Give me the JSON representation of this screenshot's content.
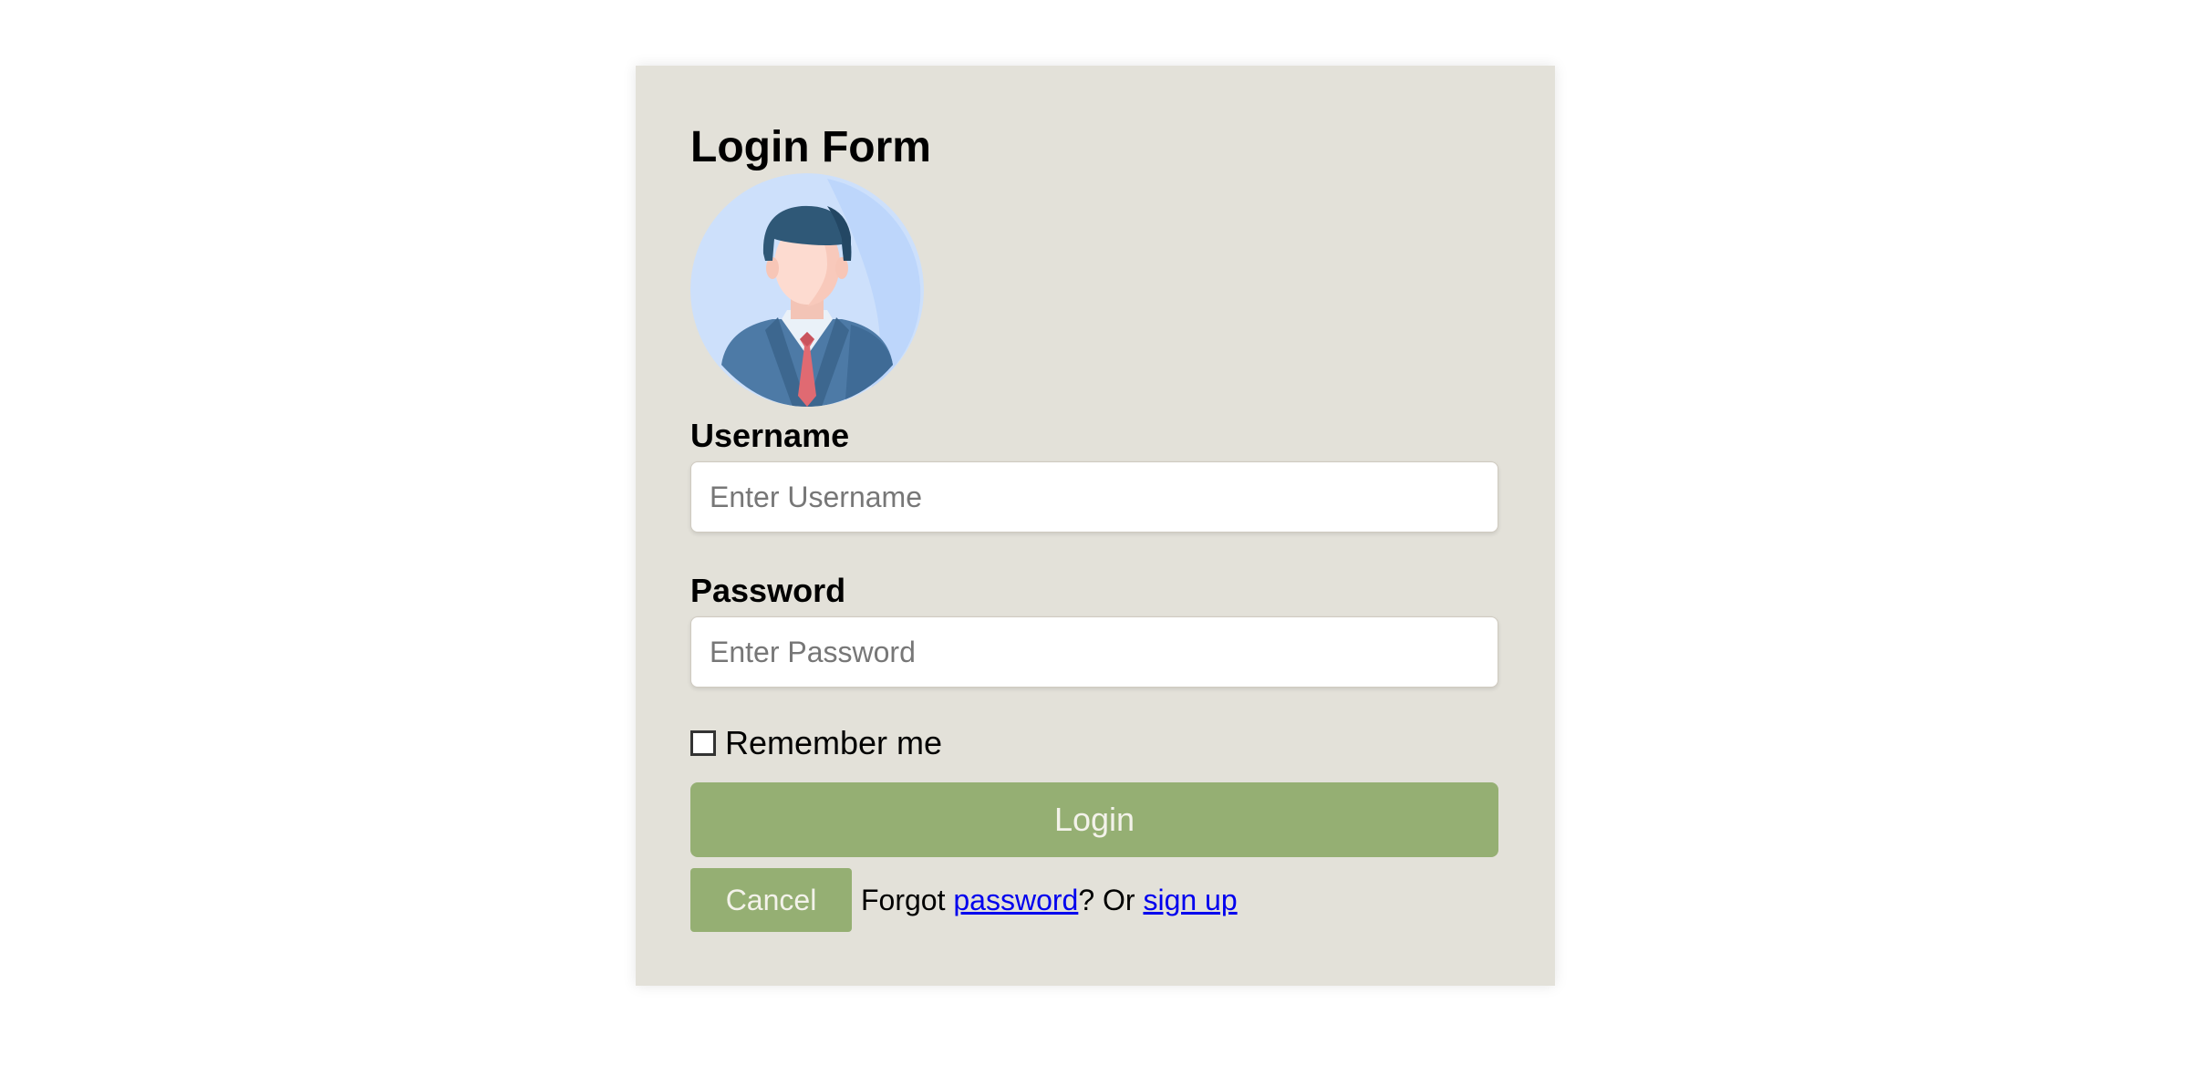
{
  "form": {
    "title": "Login Form",
    "username_label": "Username",
    "username_placeholder": "Enter Username",
    "password_label": "Password",
    "password_placeholder": "Enter Password",
    "remember_label": "Remember me",
    "remember_checked": false,
    "login_label": "Login",
    "cancel_label": "Cancel",
    "forgot_prefix": "Forgot ",
    "forgot_link": "password",
    "or_text": "? Or ",
    "signup_link": "sign up"
  },
  "avatar": {
    "icon": "user-avatar-icon"
  },
  "colors": {
    "card_bg": "#e3e1d9",
    "button_bg": "#95af73",
    "button_text": "#f3f2ea",
    "link": "#0000ee"
  }
}
